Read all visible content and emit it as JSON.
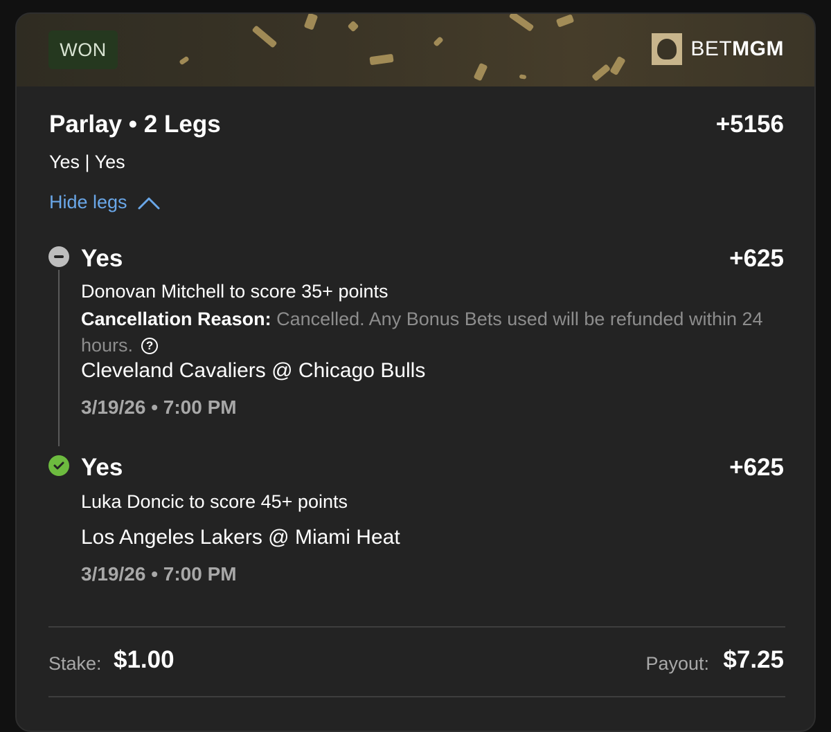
{
  "header": {
    "status_badge": "WON",
    "brand_prefix": "BET",
    "brand_suffix": "MGM",
    "accent_gold": "#b39a5f"
  },
  "bet": {
    "title": "Parlay • 2 Legs",
    "total_odds": "+5156",
    "selections": "Yes | Yes",
    "toggle_label": "Hide legs",
    "link_color": "#6aa7e8"
  },
  "legs": [
    {
      "status": "cancelled",
      "status_icon": "minus-circle-icon",
      "pick": "Yes",
      "odds": "+625",
      "market": "Donovan Mitchell to score 35+ points",
      "cancellation_label": "Cancellation Reason:",
      "cancellation_text": "Cancelled. Any Bonus Bets used will be refunded within 24 hours.",
      "help_icon_glyph": "?",
      "game": "Cleveland Cavaliers @ Chicago Bulls",
      "date": "3/19/26 • 7:00 PM"
    },
    {
      "status": "won",
      "status_icon": "check-circle-icon",
      "status_color": "#6dbb3f",
      "pick": "Yes",
      "odds": "+625",
      "market": "Luka Doncic to score 45+ points",
      "game": "Los Angeles Lakers @ Miami Heat",
      "date": "3/19/26 • 7:00 PM"
    }
  ],
  "footer": {
    "stake_label": "Stake:",
    "stake_value": "$1.00",
    "payout_label": "Payout:",
    "payout_value": "$7.25"
  }
}
